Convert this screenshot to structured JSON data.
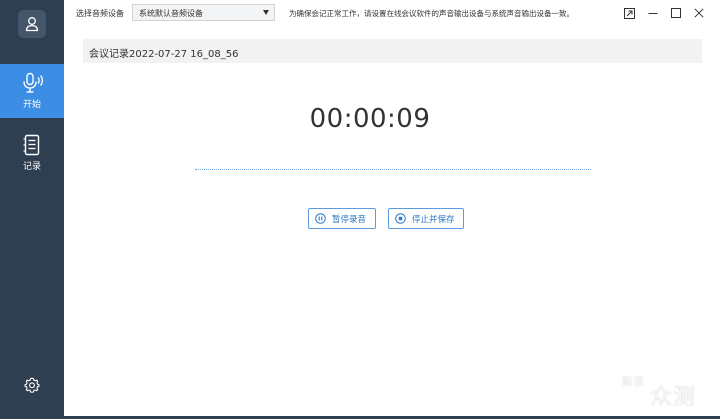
{
  "sidebar": {
    "items": [
      {
        "label": "开始",
        "icon": "microphone-icon",
        "active": true
      },
      {
        "label": "记录",
        "icon": "notebook-icon",
        "active": false
      }
    ],
    "accent_color": "#3b8ee3",
    "background_color": "#2f3f52"
  },
  "topbar": {
    "device_label": "选择音频设备",
    "device_value": "系统默认音频设备",
    "hint": "为确保会记正常工作，请设置在线会议软件的声音输出设备与系统声音输出设备一致。"
  },
  "main": {
    "record_title": "会议记录2022-07-27 16_08_56",
    "timer": "00:00:09",
    "pause_label": "暂停录音",
    "stop_label": "停止并保存"
  },
  "watermark": {
    "seal": "新浪",
    "text": "众测"
  }
}
